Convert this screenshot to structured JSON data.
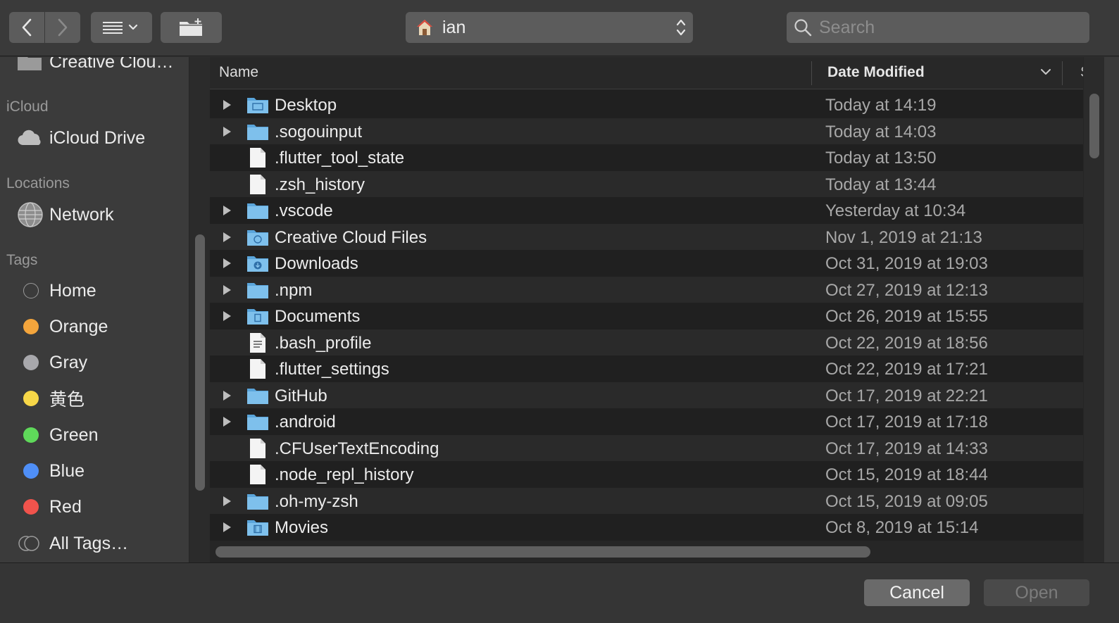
{
  "toolbar": {
    "back_icon": "chevron-left-icon",
    "forward_icon": "chevron-right-icon",
    "view_icon": "list-view-icon",
    "new_folder_icon": "new-folder-icon",
    "path_label": "ian",
    "path_icon": "home-icon",
    "search_placeholder": "Search"
  },
  "sidebar": {
    "top_item": "Creative Clou…",
    "icloud_heading": "iCloud",
    "icloud_items": [
      {
        "label": "iCloud Drive",
        "icon": "cloud-icon"
      }
    ],
    "locations_heading": "Locations",
    "locations_items": [
      {
        "label": "Network",
        "icon": "globe-icon"
      }
    ],
    "tags_heading": "Tags",
    "tags": [
      {
        "label": "Home",
        "color": "none"
      },
      {
        "label": "Orange",
        "color": "#f4a53c"
      },
      {
        "label": "Gray",
        "color": "#a8a8ac"
      },
      {
        "label": "黄色",
        "color": "#f7d748"
      },
      {
        "label": "Green",
        "color": "#5fd95a"
      },
      {
        "label": "Blue",
        "color": "#4f8ff7"
      },
      {
        "label": "Red",
        "color": "#f1534c"
      },
      {
        "label": "All Tags…",
        "color": "all"
      }
    ]
  },
  "columns": {
    "name": "Name",
    "date_modified": "Date Modified",
    "more": "S"
  },
  "files": [
    {
      "name": "Desktop",
      "date": "Today at 14:19",
      "type": "folder-desktop"
    },
    {
      "name": ".sogouinput",
      "date": "Today at 14:03",
      "type": "folder"
    },
    {
      "name": ".flutter_tool_state",
      "date": "Today at 13:50",
      "type": "file"
    },
    {
      "name": ".zsh_history",
      "date": "Today at 13:44",
      "type": "file"
    },
    {
      "name": ".vscode",
      "date": "Yesterday at 10:34",
      "type": "folder"
    },
    {
      "name": "Creative Cloud Files",
      "date": "Nov 1, 2019 at 21:13",
      "type": "folder-cc"
    },
    {
      "name": "Downloads",
      "date": "Oct 31, 2019 at 19:03",
      "type": "folder-downloads"
    },
    {
      "name": ".npm",
      "date": "Oct 27, 2019 at 12:13",
      "type": "folder"
    },
    {
      "name": "Documents",
      "date": "Oct 26, 2019 at 15:55",
      "type": "folder-documents"
    },
    {
      "name": ".bash_profile",
      "date": "Oct 22, 2019 at 18:56",
      "type": "file-text"
    },
    {
      "name": ".flutter_settings",
      "date": "Oct 22, 2019 at 17:21",
      "type": "file"
    },
    {
      "name": "GitHub",
      "date": "Oct 17, 2019 at 22:21",
      "type": "folder"
    },
    {
      "name": ".android",
      "date": "Oct 17, 2019 at 17:18",
      "type": "folder"
    },
    {
      "name": ".CFUserTextEncoding",
      "date": "Oct 17, 2019 at 14:33",
      "type": "file"
    },
    {
      "name": ".node_repl_history",
      "date": "Oct 15, 2019 at 18:44",
      "type": "file"
    },
    {
      "name": ".oh-my-zsh",
      "date": "Oct 15, 2019 at 09:05",
      "type": "folder"
    },
    {
      "name": "Movies",
      "date": "Oct 8, 2019 at 15:14",
      "type": "folder-movies"
    }
  ],
  "footer": {
    "cancel_label": "Cancel",
    "open_label": "Open"
  }
}
